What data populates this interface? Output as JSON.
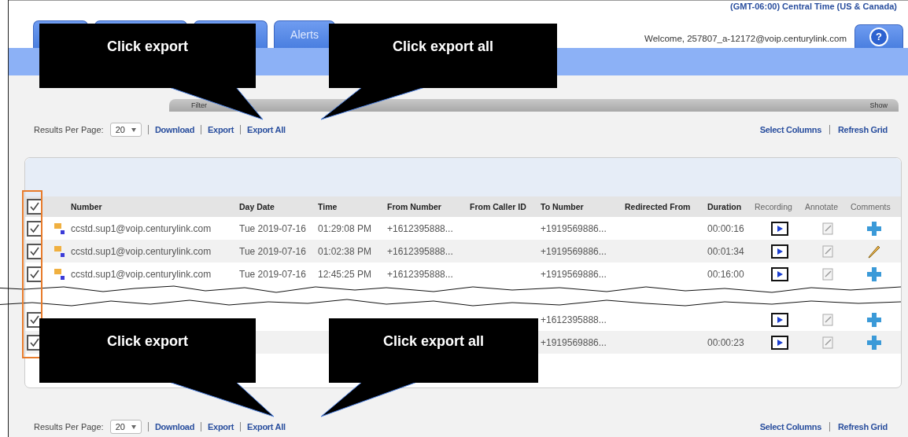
{
  "header": {
    "timezone": "(GMT-06:00) Central Time (US & Canada)",
    "welcome": "Welcome, 257807_a-12172@voip.centurylink.com",
    "help": "?"
  },
  "tabs": [
    {
      "kind": "blank"
    },
    {
      "kind": "blank"
    },
    {
      "kind": "blank"
    },
    {
      "kind": "labeled",
      "label": "Alerts"
    }
  ],
  "filter": {
    "label": "Filter",
    "toggle": "Show"
  },
  "toolbars": [
    {
      "results_label": "Results Per Page:",
      "page_size": "20",
      "links": [
        "Download",
        "Export",
        "Export All"
      ],
      "right_links": [
        "Select Columns",
        "Refresh Grid"
      ]
    },
    {
      "results_label": "Results Per Page:",
      "page_size": "20",
      "links": [
        "Download",
        "Export",
        "Export All"
      ],
      "right_links": [
        "Select Columns",
        "Refresh Grid"
      ]
    }
  ],
  "table": {
    "header_checked": true,
    "columns": [
      "Number",
      "Day Date",
      "Time",
      "From Number",
      "From Caller ID",
      "To Number",
      "Redirected From",
      "Duration",
      "Recording",
      "Annotate",
      "Comments"
    ],
    "rows": [
      {
        "checked": true,
        "number": "ccstd.sup1@voip.centurylink.com",
        "day_date": "Tue 2019-07-16",
        "time": "01:29:08 PM",
        "from_number": "+1612395888...",
        "to_number": "+1919569886...",
        "duration": "00:00:16",
        "kind": "add"
      },
      {
        "checked": true,
        "number": "ccstd.sup1@voip.centurylink.com",
        "day_date": "Tue 2019-07-16",
        "time": "01:02:38 PM",
        "from_number": "+1612395888...",
        "to_number": "+1919569886...",
        "duration": "00:01:34",
        "kind": "edit"
      },
      {
        "checked": true,
        "number": "ccstd.sup1@voip.centurylink.com",
        "day_date": "Tue 2019-07-16",
        "time": "12:45:25 PM",
        "from_number": "+1612395888...",
        "to_number": "+1919569886...",
        "duration": "00:16:00",
        "kind": "add"
      },
      {
        "kind": "tear"
      },
      {
        "checked": true,
        "to_number": "+1612395888...",
        "kind": "add"
      },
      {
        "checked": true,
        "to_number": "+1919569886...",
        "duration": "00:00:23",
        "kind": "add"
      }
    ]
  },
  "callouts": [
    {
      "text": "Click export"
    },
    {
      "text": "Click export all"
    },
    {
      "text": "Click export"
    },
    {
      "text": "Click export all"
    }
  ]
}
